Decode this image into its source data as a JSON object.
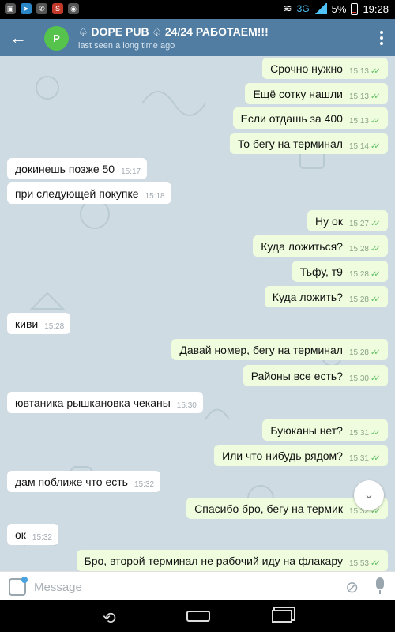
{
  "status_bar": {
    "network": "3G",
    "battery": "5%",
    "time": "19:28"
  },
  "header": {
    "title": "♤ DOPE PUB ♤ 24/24 РАБОТАЕМ!!!",
    "subtitle": "last seen a long time ago",
    "avatar_letter": "P",
    "avatar_color": "#55c34c",
    "bar_color": "#517da2"
  },
  "messages": [
    {
      "dir": "out",
      "text": "Срочно нужно",
      "time": "15:13"
    },
    {
      "dir": "out",
      "text": "Ещё сотку нашли",
      "time": "15:13"
    },
    {
      "dir": "out",
      "text": "Если отдашь за 400",
      "time": "15:13"
    },
    {
      "dir": "out",
      "text": "То бегу на терминал",
      "time": "15:14"
    },
    {
      "dir": "in",
      "text": "докинешь позже 50",
      "time": "15:17"
    },
    {
      "dir": "in",
      "text": "при следующей покупке",
      "time": "15:18"
    },
    {
      "dir": "out",
      "text": "Ну ок",
      "time": "15:27"
    },
    {
      "dir": "out",
      "text": "Куда ложиться?",
      "time": "15:28"
    },
    {
      "dir": "out",
      "text": "Тьфу, т9",
      "time": "15:28"
    },
    {
      "dir": "out",
      "text": "Куда ложить?",
      "time": "15:28"
    },
    {
      "dir": "in",
      "text": "киви",
      "time": "15:28"
    },
    {
      "dir": "out",
      "text": "Давай номер, бегу на терминал",
      "time": "15:28"
    },
    {
      "dir": "out",
      "text": "Районы все есть?",
      "time": "15:30"
    },
    {
      "dir": "in",
      "text": "ювтаника рышкановка чеканы",
      "time": "15:30"
    },
    {
      "dir": "out",
      "text": "Буюканы нет?",
      "time": "15:31"
    },
    {
      "dir": "out",
      "text": "Или что нибудь рядом?",
      "time": "15:31"
    },
    {
      "dir": "in",
      "text": "дам поближе что есть",
      "time": "15:32"
    },
    {
      "dir": "out",
      "text": "Спасибо бро, бегу на термик",
      "time": "15:32"
    },
    {
      "dir": "in",
      "text": "ок",
      "time": "15:32"
    },
    {
      "dir": "out",
      "text": "Бро, второй терминал не рабочий иду на флакару",
      "time": "15:53"
    }
  ],
  "composer": {
    "placeholder": "Message",
    "value": ""
  },
  "colors": {
    "outgoing_bubble": "#effdde",
    "incoming_bubble": "#ffffff",
    "chat_background": "#cfdbe2",
    "read_check": "#5fbe64"
  }
}
